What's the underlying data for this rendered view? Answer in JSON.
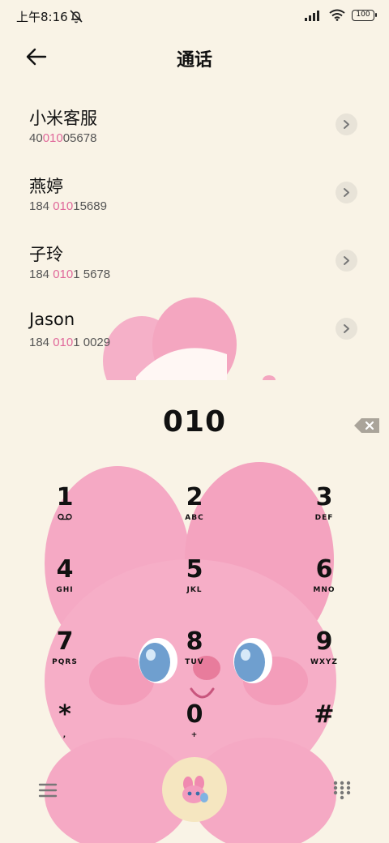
{
  "status_bar": {
    "time": "上午8:16",
    "battery": "100"
  },
  "header": {
    "title": "通话"
  },
  "contacts": [
    {
      "name": "小米客服",
      "number_pre": "40",
      "number_match": "010",
      "number_post": "05678"
    },
    {
      "name": "燕婷",
      "number_pre": "184 ",
      "number_match": "010",
      "number_post": "15689"
    },
    {
      "name": "子玲",
      "number_pre": "184 ",
      "number_match": "010",
      "number_post": "1 5678"
    },
    {
      "name": "Jason",
      "number_pre": "184 ",
      "number_match": "010",
      "number_post": "1 0029"
    }
  ],
  "dialer": {
    "input": "010"
  },
  "keys": [
    {
      "digit": "1",
      "letters": ""
    },
    {
      "digit": "2",
      "letters": "ABC"
    },
    {
      "digit": "3",
      "letters": "DEF"
    },
    {
      "digit": "4",
      "letters": "GHI"
    },
    {
      "digit": "5",
      "letters": "JKL"
    },
    {
      "digit": "6",
      "letters": "MNO"
    },
    {
      "digit": "7",
      "letters": "PQRS"
    },
    {
      "digit": "8",
      "letters": "TUV"
    },
    {
      "digit": "9",
      "letters": "WXYZ"
    },
    {
      "digit": "*",
      "letters": ","
    },
    {
      "digit": "0",
      "letters": "+"
    },
    {
      "digit": "#",
      "letters": ""
    }
  ],
  "colors": {
    "background": "#f9f3e6",
    "highlight": "#e0689a",
    "bunny": "#f5a9c4",
    "call_button": "#f5e6c0"
  },
  "icons": {
    "back": "arrow-left-icon",
    "backspace": "backspace-icon",
    "voicemail": "voicemail-icon",
    "menu": "menu-icon",
    "keypad": "keypad-grid-icon",
    "call": "bunny-call-icon"
  }
}
